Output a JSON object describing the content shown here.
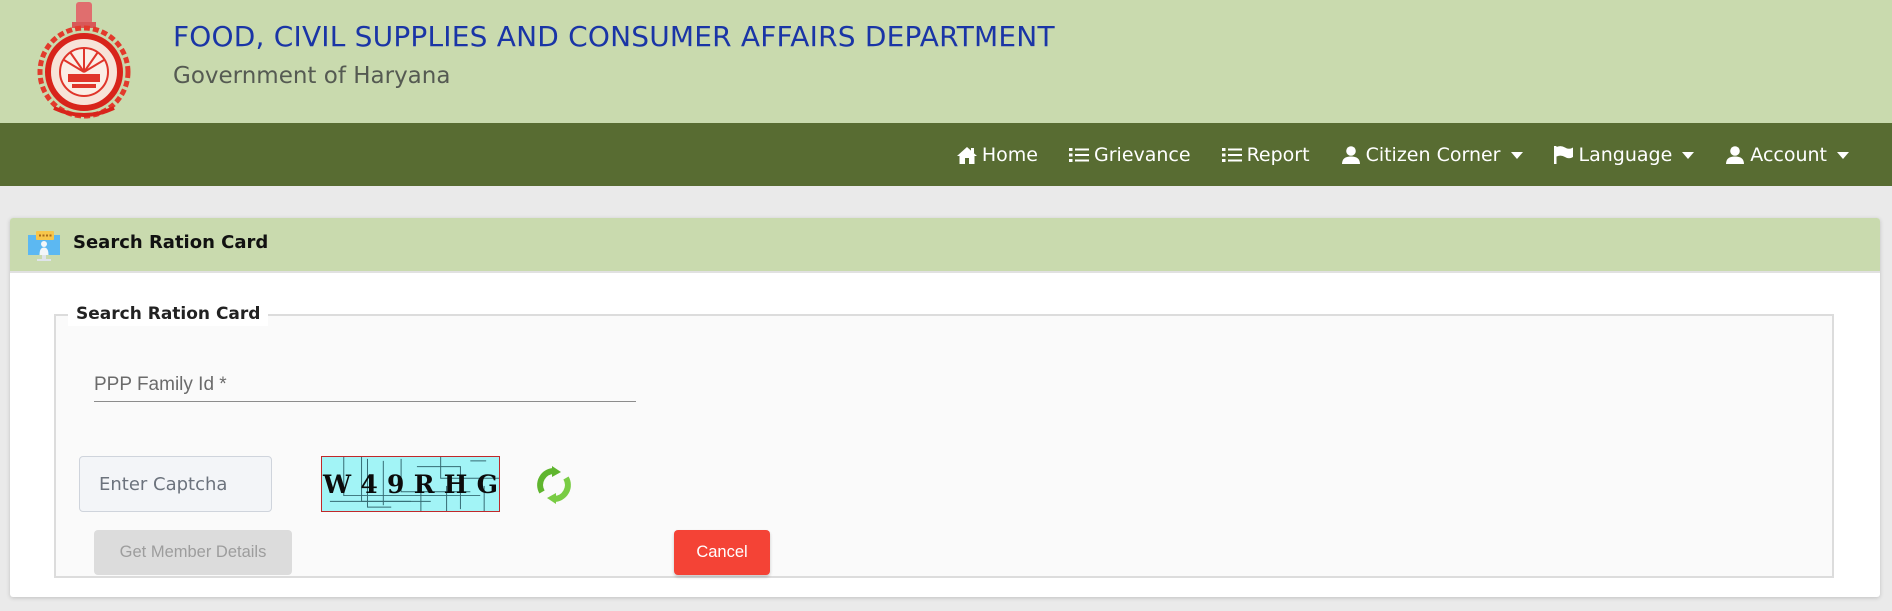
{
  "header": {
    "department_title": "FOOD, CIVIL SUPPLIES AND CONSUMER AFFAIRS DEPARTMENT",
    "government_title": "Government of Haryana",
    "emblem_icon": "haryana-govt-emblem"
  },
  "navbar": {
    "items": [
      {
        "label": "Home",
        "icon": "home-icon",
        "dropdown": false
      },
      {
        "label": "Grievance",
        "icon": "list-icon",
        "dropdown": false
      },
      {
        "label": "Report",
        "icon": "list-icon",
        "dropdown": false
      },
      {
        "label": "Citizen Corner",
        "icon": "user-icon",
        "dropdown": true
      },
      {
        "label": "Language",
        "icon": "flag-icon",
        "dropdown": true
      },
      {
        "label": "Account",
        "icon": "user-icon",
        "dropdown": true
      }
    ]
  },
  "card": {
    "title": "Search Ration Card",
    "icon": "monitor-user-icon"
  },
  "form": {
    "legend": "Search Ration Card",
    "ppp_family_id": {
      "label": "PPP Family Id *",
      "value": ""
    },
    "captcha_input": {
      "placeholder": "Enter Captcha",
      "value": ""
    },
    "captcha_characters": [
      "W",
      "4",
      "9",
      "R",
      "H",
      "G"
    ],
    "buttons": {
      "get_member_details": "Get Member Details",
      "cancel": "Cancel"
    }
  },
  "colors": {
    "header_bg": "#c9daae",
    "navbar_bg": "#586c32",
    "title_blue": "#1a35a6",
    "cancel_red": "#f44336",
    "refresh_green": "#6cc23a"
  }
}
